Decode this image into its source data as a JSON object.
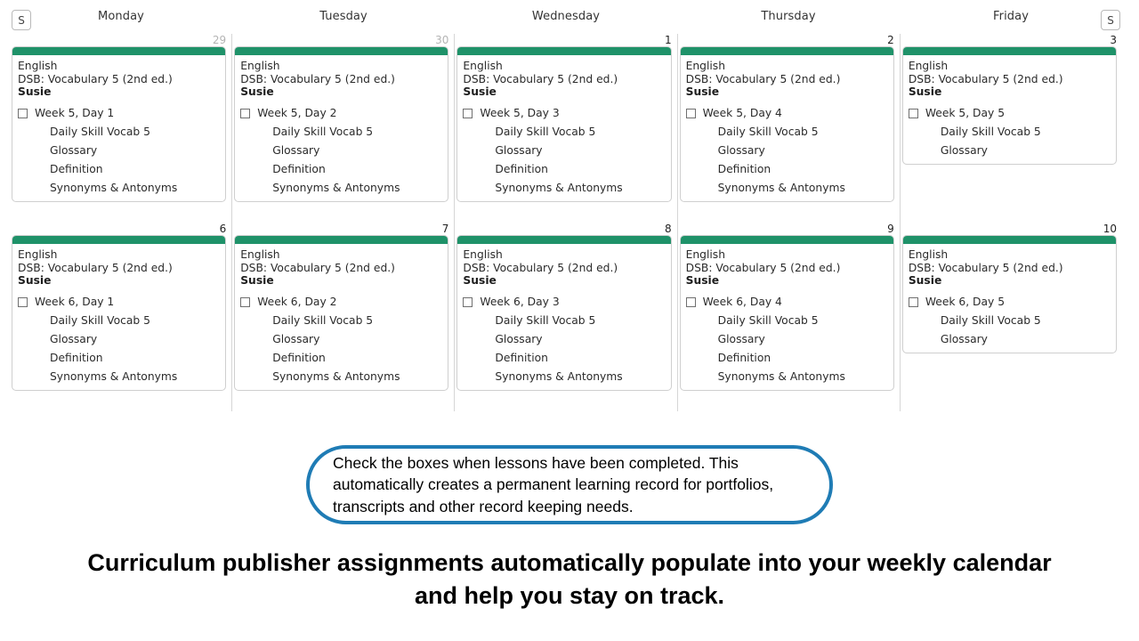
{
  "nav": {
    "prev_button_label": "S",
    "next_button_label": "S"
  },
  "calendar": {
    "weekday_headers": [
      "Monday",
      "Tuesday",
      "Wednesday",
      "Thursday",
      "Friday"
    ],
    "accent_color": "#1f9269",
    "muted_daynum_color": "#b4b4b4",
    "weeks": [
      {
        "days": [
          {
            "daynum": "29",
            "daynum_muted": true,
            "card": {
              "subject": "English",
              "course": "DSB: Vocabulary 5 (2nd ed.)",
              "student": "Susie",
              "task": "Week 5, Day 1",
              "checked": false,
              "items": [
                "Daily Skill Vocab 5",
                "Glossary",
                "Definition",
                "Synonyms & Antonyms"
              ]
            }
          },
          {
            "daynum": "30",
            "daynum_muted": true,
            "card": {
              "subject": "English",
              "course": "DSB: Vocabulary 5 (2nd ed.)",
              "student": "Susie",
              "task": "Week 5, Day 2",
              "checked": false,
              "items": [
                "Daily Skill Vocab 5",
                "Glossary",
                "Definition",
                "Synonyms & Antonyms"
              ]
            }
          },
          {
            "daynum": "1",
            "daynum_muted": false,
            "card": {
              "subject": "English",
              "course": "DSB: Vocabulary 5 (2nd ed.)",
              "student": "Susie",
              "task": "Week 5, Day 3",
              "checked": false,
              "items": [
                "Daily Skill Vocab 5",
                "Glossary",
                "Definition",
                "Synonyms & Antonyms"
              ]
            }
          },
          {
            "daynum": "2",
            "daynum_muted": false,
            "card": {
              "subject": "English",
              "course": "DSB: Vocabulary 5 (2nd ed.)",
              "student": "Susie",
              "task": "Week 5, Day 4",
              "checked": false,
              "items": [
                "Daily Skill Vocab 5",
                "Glossary",
                "Definition",
                "Synonyms & Antonyms"
              ]
            }
          },
          {
            "daynum": "3",
            "daynum_muted": false,
            "card": {
              "subject": "English",
              "course": "DSB: Vocabulary 5 (2nd ed.)",
              "student": "Susie",
              "task": "Week 5, Day 5",
              "checked": false,
              "items": [
                "Daily Skill Vocab 5",
                "Glossary"
              ]
            }
          }
        ]
      },
      {
        "days": [
          {
            "daynum": "6",
            "daynum_muted": false,
            "card": {
              "subject": "English",
              "course": "DSB: Vocabulary 5 (2nd ed.)",
              "student": "Susie",
              "task": "Week 6, Day 1",
              "checked": false,
              "items": [
                "Daily Skill Vocab 5",
                "Glossary",
                "Definition",
                "Synonyms & Antonyms"
              ]
            }
          },
          {
            "daynum": "7",
            "daynum_muted": false,
            "card": {
              "subject": "English",
              "course": "DSB: Vocabulary 5 (2nd ed.)",
              "student": "Susie",
              "task": "Week 6, Day 2",
              "checked": false,
              "items": [
                "Daily Skill Vocab 5",
                "Glossary",
                "Definition",
                "Synonyms & Antonyms"
              ]
            }
          },
          {
            "daynum": "8",
            "daynum_muted": false,
            "card": {
              "subject": "English",
              "course": "DSB: Vocabulary 5 (2nd ed.)",
              "student": "Susie",
              "task": "Week 6, Day 3",
              "checked": false,
              "items": [
                "Daily Skill Vocab 5",
                "Glossary",
                "Definition",
                "Synonyms & Antonyms"
              ]
            }
          },
          {
            "daynum": "9",
            "daynum_muted": false,
            "card": {
              "subject": "English",
              "course": "DSB: Vocabulary 5 (2nd ed.)",
              "student": "Susie",
              "task": "Week 6, Day 4",
              "checked": false,
              "items": [
                "Daily Skill Vocab 5",
                "Glossary",
                "Definition",
                "Synonyms & Antonyms"
              ]
            }
          },
          {
            "daynum": "10",
            "daynum_muted": false,
            "card": {
              "subject": "English",
              "course": "DSB: Vocabulary 5 (2nd ed.)",
              "student": "Susie",
              "task": "Week 6, Day 5",
              "checked": false,
              "items": [
                "Daily Skill Vocab 5",
                "Glossary"
              ]
            }
          }
        ]
      }
    ]
  },
  "callout": {
    "text": "Check the boxes when lessons have been completed. This automatically creates a permanent learning record for portfolios, transcripts and other record keeping needs.",
    "border_color": "#1f7cb5"
  },
  "headline": {
    "text": "Curriculum publisher assignments automatically populate into your weekly calendar and help you stay on track."
  }
}
